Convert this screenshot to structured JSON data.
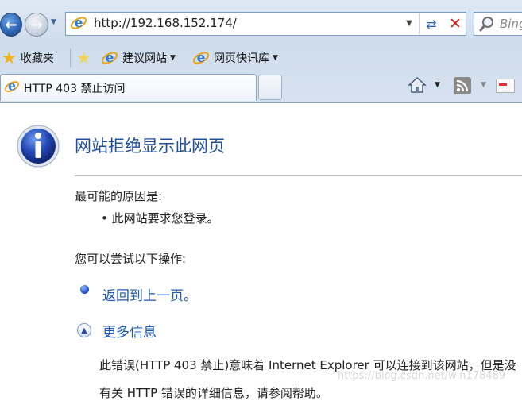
{
  "toolbar": {
    "address": "http://192.168.152.174/",
    "search_placeholder": "Bing"
  },
  "favorites_bar": {
    "favorites_label": "收藏夹",
    "items": [
      {
        "label": "建议网站"
      },
      {
        "label": "网页快讯库"
      }
    ]
  },
  "tab": {
    "title": "HTTP 403 禁止访问"
  },
  "page": {
    "title": "网站拒绝显示此网页",
    "reason_heading": "最可能的原因是:",
    "reason_bullet": "• 此网站要求您登录。",
    "try_heading": "您可以尝试以下操作:",
    "back_link": "返回到上一页。",
    "more_info_link": "更多信息",
    "detail_line_1": "此错误(HTTP 403 禁止)意味着 Internet Explorer 可以连接到该网站，但是没",
    "detail_line_2": "有关 HTTP 错误的详细信息，请参阅帮助。",
    "watermark": "https://blog.csdn.net/win178489"
  },
  "colors": {
    "link": "#1f5bb5",
    "title": "#1f4f9a",
    "stop": "#c8201a"
  }
}
